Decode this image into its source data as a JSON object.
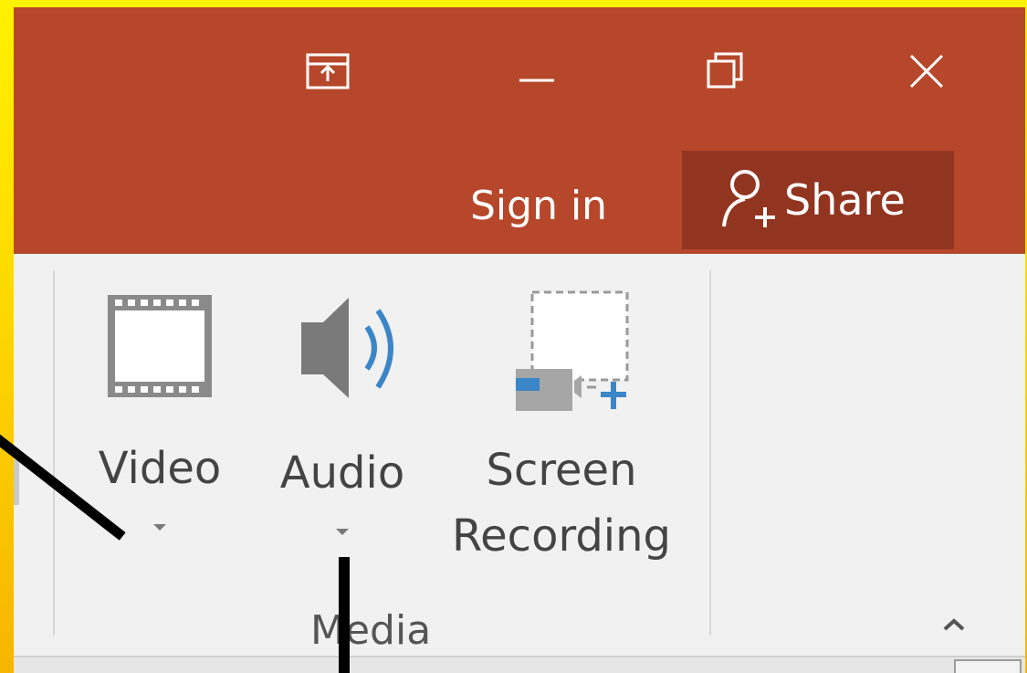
{
  "titlebar": {
    "buttons": [
      {
        "name": "ribbon-display-options",
        "icon": "ribbon-display-icon"
      },
      {
        "name": "minimize",
        "icon": "minimize-icon"
      },
      {
        "name": "restore",
        "icon": "restore-icon"
      },
      {
        "name": "close",
        "icon": "close-icon"
      }
    ],
    "sign_in_label": "Sign in",
    "share_label": "Share",
    "share_icon": "add-person-icon"
  },
  "ribbon": {
    "group_label": "Media",
    "commands": [
      {
        "label": "Video",
        "icon": "film-icon",
        "has_dropdown": true
      },
      {
        "label": "Audio",
        "icon": "speaker-icon",
        "has_dropdown": true
      },
      {
        "label_line1": "Screen",
        "label_line2": "Recording",
        "icon": "screen-recording-icon",
        "has_dropdown": false
      }
    ],
    "collapse_icon": "chevron-up-icon"
  },
  "colors": {
    "titlebar": "#b7472a",
    "share_button": "#913520",
    "ribbon_bg": "#f1f1f1",
    "accent_blue": "#3a86c8",
    "background_yellow": "#ffd800"
  }
}
